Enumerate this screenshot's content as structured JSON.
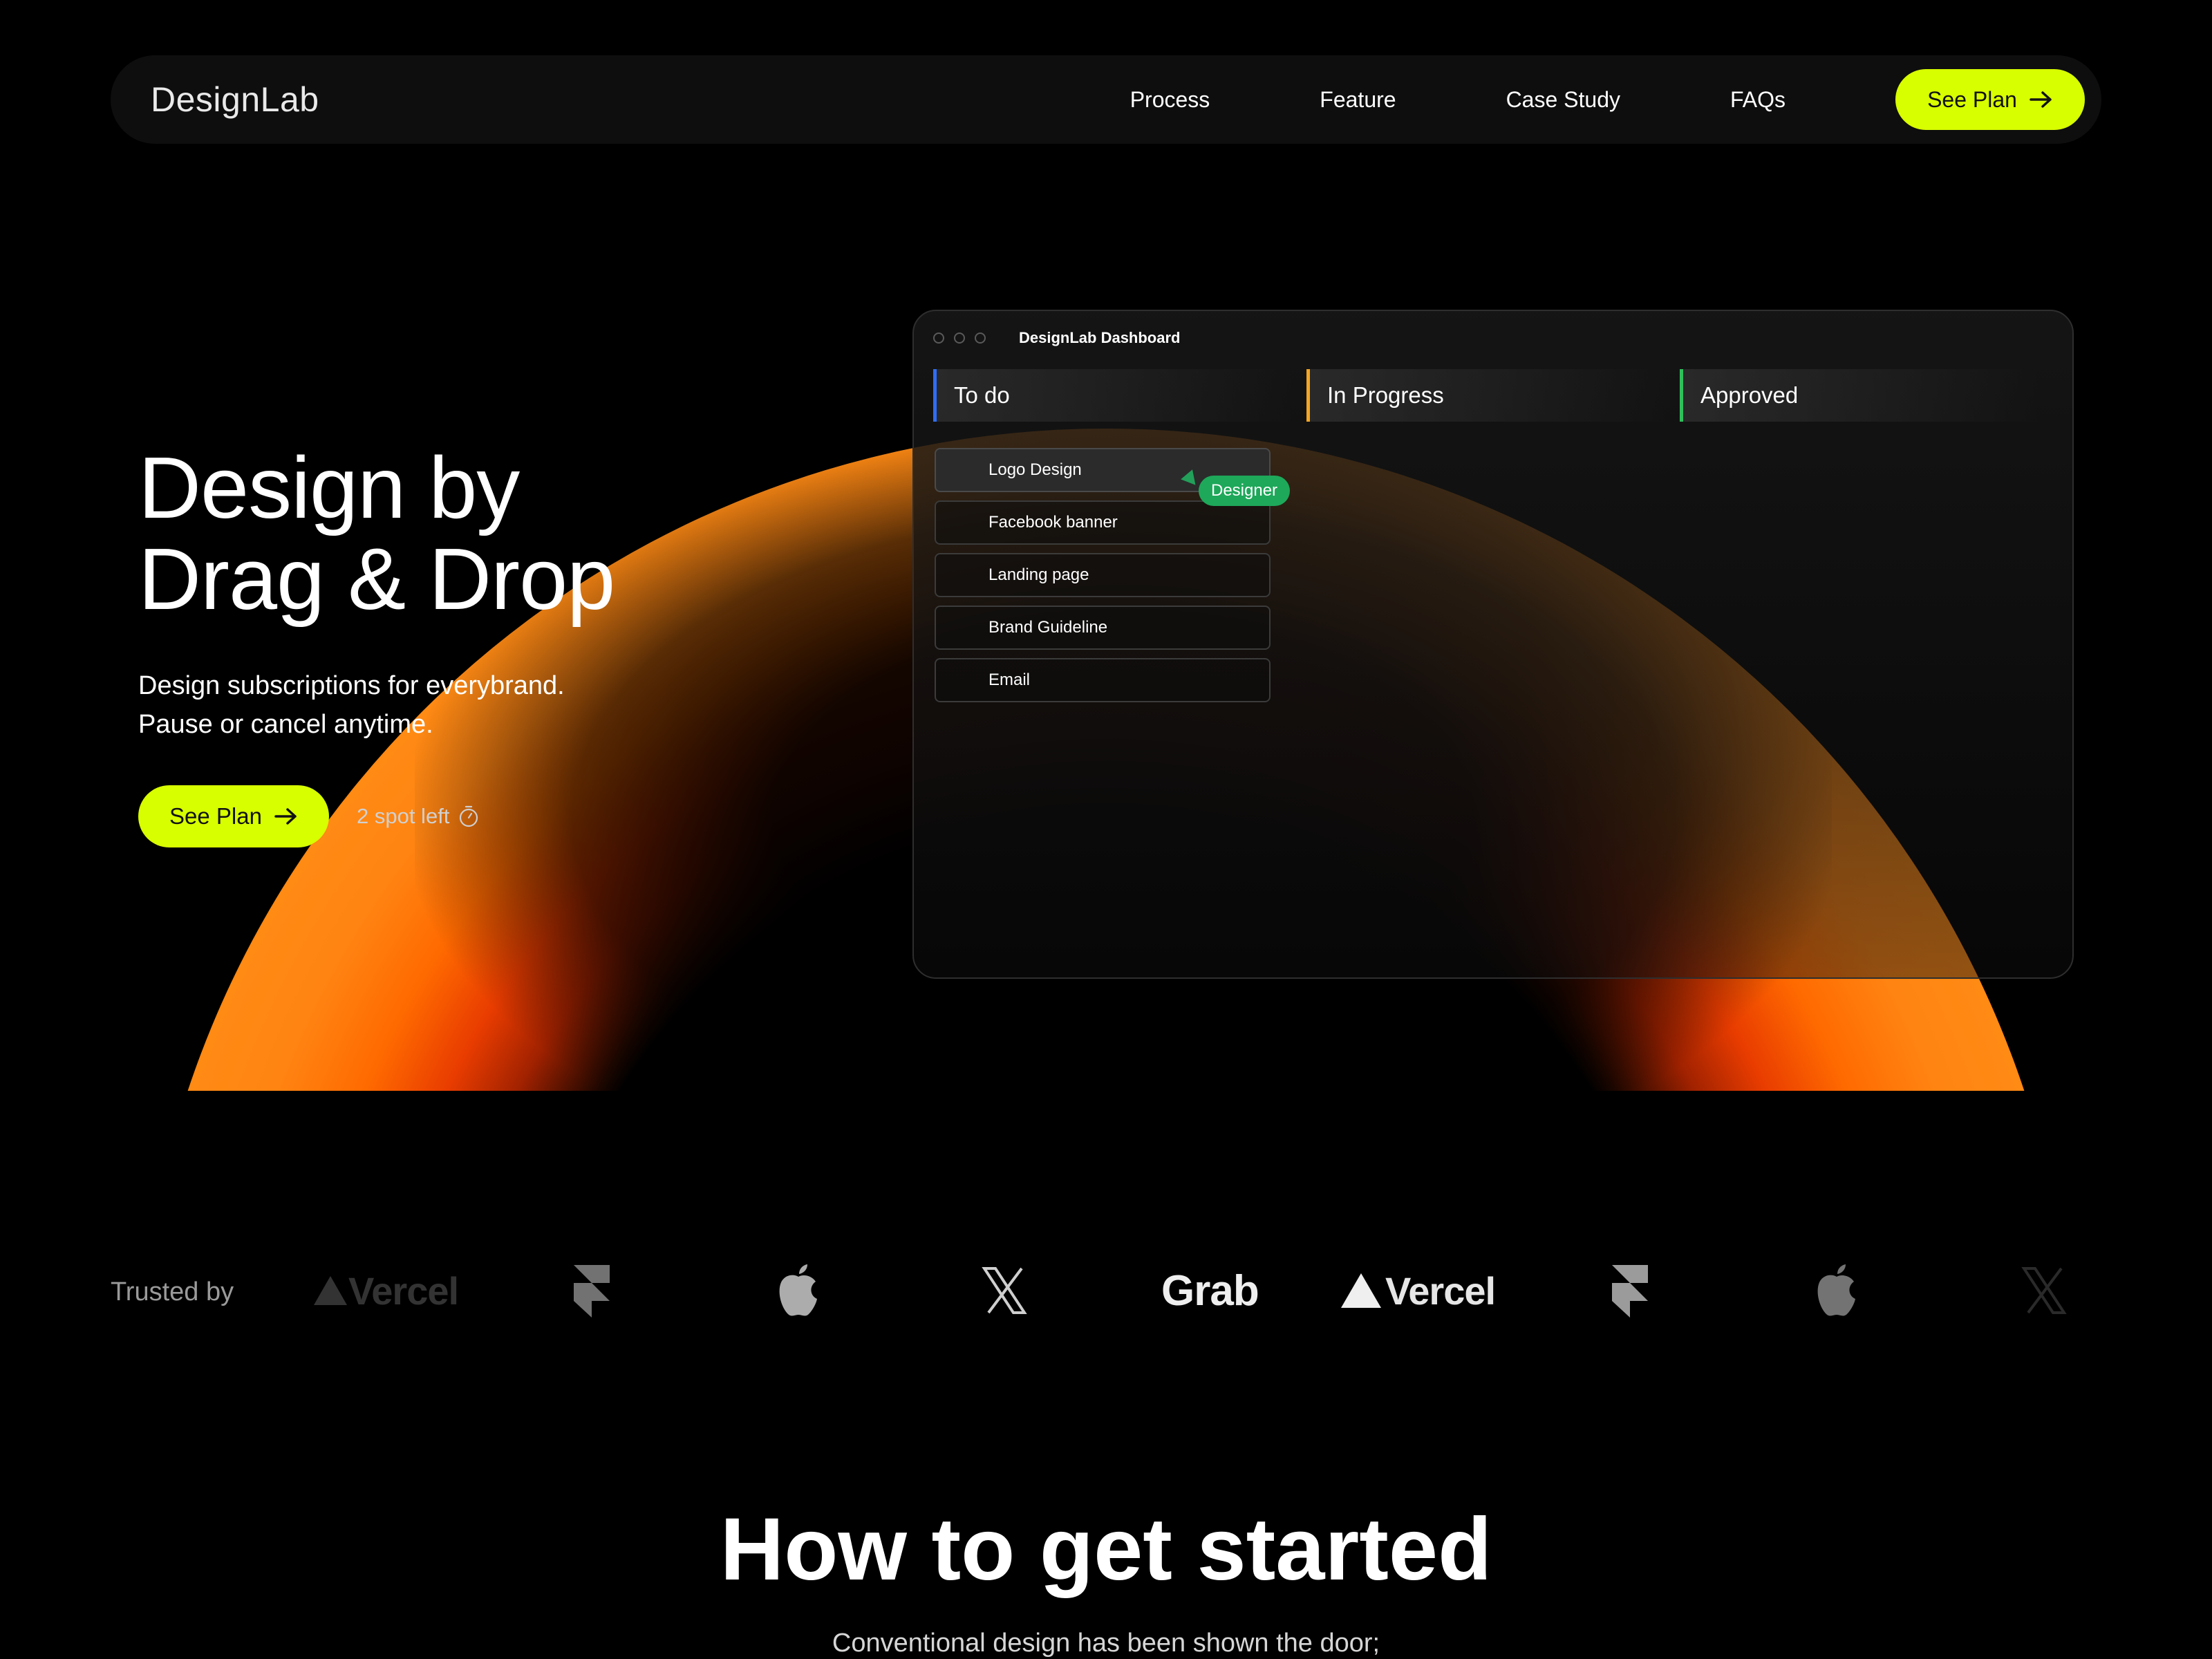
{
  "nav": {
    "brand": "DesignLab",
    "links": [
      "Process",
      "Feature",
      "Case Study",
      "FAQs"
    ],
    "cta": "See Plan"
  },
  "hero": {
    "title_line1": "Design by",
    "title_line2": "Drag & Drop",
    "subtitle_line1": "Design subscriptions for everybrand.",
    "subtitle_line2": "Pause or cancel anytime.",
    "cta": "See Plan",
    "spots": "2 spot left"
  },
  "dashboard": {
    "title": "DesignLab Dashboard",
    "columns": [
      {
        "label": "To do",
        "color": "#2f6df6"
      },
      {
        "label": "In Progress",
        "color": "#f5a623"
      },
      {
        "label": "Approved",
        "color": "#2fc05a"
      }
    ],
    "tasks": [
      "Logo Design",
      "Facebook banner",
      "Landing page",
      "Brand Guideline",
      "Email"
    ],
    "badge": "Designer"
  },
  "trusted": {
    "label": "Trusted by",
    "logos": [
      "Vercel",
      "framer-icon",
      "apple-icon",
      "x-icon",
      "Grab",
      "Vercel",
      "framer-icon",
      "apple-icon",
      "x-icon"
    ]
  },
  "how": {
    "title": "How to get started",
    "subtitle": "Conventional design has been shown the door;"
  },
  "colors": {
    "accent": "#d8ff00",
    "arc_orange": "#ff8a14",
    "arc_red": "#e83c00",
    "badge_green": "#1ea85a"
  }
}
